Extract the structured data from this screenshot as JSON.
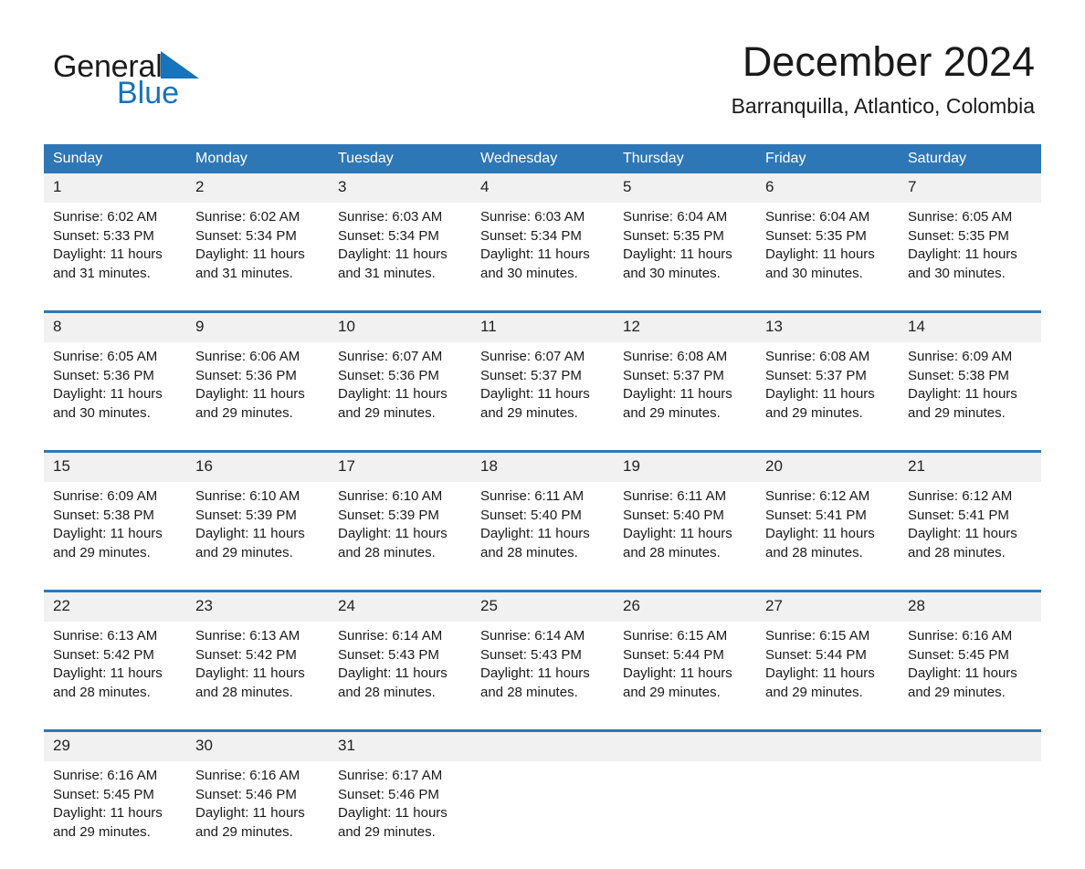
{
  "brand": {
    "name_part1": "General",
    "name_part2": "Blue",
    "accent_color": "#1673bd",
    "triangle_icon": "brand-triangle-icon"
  },
  "header": {
    "title": "December 2024",
    "location": "Barranquilla, Atlantico, Colombia"
  },
  "calendar": {
    "header_bg": "#2e77b6",
    "daynum_bg": "#f1f1f1",
    "weekdays": [
      "Sunday",
      "Monday",
      "Tuesday",
      "Wednesday",
      "Thursday",
      "Friday",
      "Saturday"
    ],
    "weeks": [
      [
        {
          "day": "1",
          "sunrise": "Sunrise: 6:02 AM",
          "sunset": "Sunset: 5:33 PM",
          "daylight": "Daylight: 11 hours and 31 minutes."
        },
        {
          "day": "2",
          "sunrise": "Sunrise: 6:02 AM",
          "sunset": "Sunset: 5:34 PM",
          "daylight": "Daylight: 11 hours and 31 minutes."
        },
        {
          "day": "3",
          "sunrise": "Sunrise: 6:03 AM",
          "sunset": "Sunset: 5:34 PM",
          "daylight": "Daylight: 11 hours and 31 minutes."
        },
        {
          "day": "4",
          "sunrise": "Sunrise: 6:03 AM",
          "sunset": "Sunset: 5:34 PM",
          "daylight": "Daylight: 11 hours and 30 minutes."
        },
        {
          "day": "5",
          "sunrise": "Sunrise: 6:04 AM",
          "sunset": "Sunset: 5:35 PM",
          "daylight": "Daylight: 11 hours and 30 minutes."
        },
        {
          "day": "6",
          "sunrise": "Sunrise: 6:04 AM",
          "sunset": "Sunset: 5:35 PM",
          "daylight": "Daylight: 11 hours and 30 minutes."
        },
        {
          "day": "7",
          "sunrise": "Sunrise: 6:05 AM",
          "sunset": "Sunset: 5:35 PM",
          "daylight": "Daylight: 11 hours and 30 minutes."
        }
      ],
      [
        {
          "day": "8",
          "sunrise": "Sunrise: 6:05 AM",
          "sunset": "Sunset: 5:36 PM",
          "daylight": "Daylight: 11 hours and 30 minutes."
        },
        {
          "day": "9",
          "sunrise": "Sunrise: 6:06 AM",
          "sunset": "Sunset: 5:36 PM",
          "daylight": "Daylight: 11 hours and 29 minutes."
        },
        {
          "day": "10",
          "sunrise": "Sunrise: 6:07 AM",
          "sunset": "Sunset: 5:36 PM",
          "daylight": "Daylight: 11 hours and 29 minutes."
        },
        {
          "day": "11",
          "sunrise": "Sunrise: 6:07 AM",
          "sunset": "Sunset: 5:37 PM",
          "daylight": "Daylight: 11 hours and 29 minutes."
        },
        {
          "day": "12",
          "sunrise": "Sunrise: 6:08 AM",
          "sunset": "Sunset: 5:37 PM",
          "daylight": "Daylight: 11 hours and 29 minutes."
        },
        {
          "day": "13",
          "sunrise": "Sunrise: 6:08 AM",
          "sunset": "Sunset: 5:37 PM",
          "daylight": "Daylight: 11 hours and 29 minutes."
        },
        {
          "day": "14",
          "sunrise": "Sunrise: 6:09 AM",
          "sunset": "Sunset: 5:38 PM",
          "daylight": "Daylight: 11 hours and 29 minutes."
        }
      ],
      [
        {
          "day": "15",
          "sunrise": "Sunrise: 6:09 AM",
          "sunset": "Sunset: 5:38 PM",
          "daylight": "Daylight: 11 hours and 29 minutes."
        },
        {
          "day": "16",
          "sunrise": "Sunrise: 6:10 AM",
          "sunset": "Sunset: 5:39 PM",
          "daylight": "Daylight: 11 hours and 29 minutes."
        },
        {
          "day": "17",
          "sunrise": "Sunrise: 6:10 AM",
          "sunset": "Sunset: 5:39 PM",
          "daylight": "Daylight: 11 hours and 28 minutes."
        },
        {
          "day": "18",
          "sunrise": "Sunrise: 6:11 AM",
          "sunset": "Sunset: 5:40 PM",
          "daylight": "Daylight: 11 hours and 28 minutes."
        },
        {
          "day": "19",
          "sunrise": "Sunrise: 6:11 AM",
          "sunset": "Sunset: 5:40 PM",
          "daylight": "Daylight: 11 hours and 28 minutes."
        },
        {
          "day": "20",
          "sunrise": "Sunrise: 6:12 AM",
          "sunset": "Sunset: 5:41 PM",
          "daylight": "Daylight: 11 hours and 28 minutes."
        },
        {
          "day": "21",
          "sunrise": "Sunrise: 6:12 AM",
          "sunset": "Sunset: 5:41 PM",
          "daylight": "Daylight: 11 hours and 28 minutes."
        }
      ],
      [
        {
          "day": "22",
          "sunrise": "Sunrise: 6:13 AM",
          "sunset": "Sunset: 5:42 PM",
          "daylight": "Daylight: 11 hours and 28 minutes."
        },
        {
          "day": "23",
          "sunrise": "Sunrise: 6:13 AM",
          "sunset": "Sunset: 5:42 PM",
          "daylight": "Daylight: 11 hours and 28 minutes."
        },
        {
          "day": "24",
          "sunrise": "Sunrise: 6:14 AM",
          "sunset": "Sunset: 5:43 PM",
          "daylight": "Daylight: 11 hours and 28 minutes."
        },
        {
          "day": "25",
          "sunrise": "Sunrise: 6:14 AM",
          "sunset": "Sunset: 5:43 PM",
          "daylight": "Daylight: 11 hours and 28 minutes."
        },
        {
          "day": "26",
          "sunrise": "Sunrise: 6:15 AM",
          "sunset": "Sunset: 5:44 PM",
          "daylight": "Daylight: 11 hours and 29 minutes."
        },
        {
          "day": "27",
          "sunrise": "Sunrise: 6:15 AM",
          "sunset": "Sunset: 5:44 PM",
          "daylight": "Daylight: 11 hours and 29 minutes."
        },
        {
          "day": "28",
          "sunrise": "Sunrise: 6:16 AM",
          "sunset": "Sunset: 5:45 PM",
          "daylight": "Daylight: 11 hours and 29 minutes."
        }
      ],
      [
        {
          "day": "29",
          "sunrise": "Sunrise: 6:16 AM",
          "sunset": "Sunset: 5:45 PM",
          "daylight": "Daylight: 11 hours and 29 minutes."
        },
        {
          "day": "30",
          "sunrise": "Sunrise: 6:16 AM",
          "sunset": "Sunset: 5:46 PM",
          "daylight": "Daylight: 11 hours and 29 minutes."
        },
        {
          "day": "31",
          "sunrise": "Sunrise: 6:17 AM",
          "sunset": "Sunset: 5:46 PM",
          "daylight": "Daylight: 11 hours and 29 minutes."
        },
        {
          "day": "",
          "sunrise": "",
          "sunset": "",
          "daylight": ""
        },
        {
          "day": "",
          "sunrise": "",
          "sunset": "",
          "daylight": ""
        },
        {
          "day": "",
          "sunrise": "",
          "sunset": "",
          "daylight": ""
        },
        {
          "day": "",
          "sunrise": "",
          "sunset": "",
          "daylight": ""
        }
      ]
    ]
  }
}
